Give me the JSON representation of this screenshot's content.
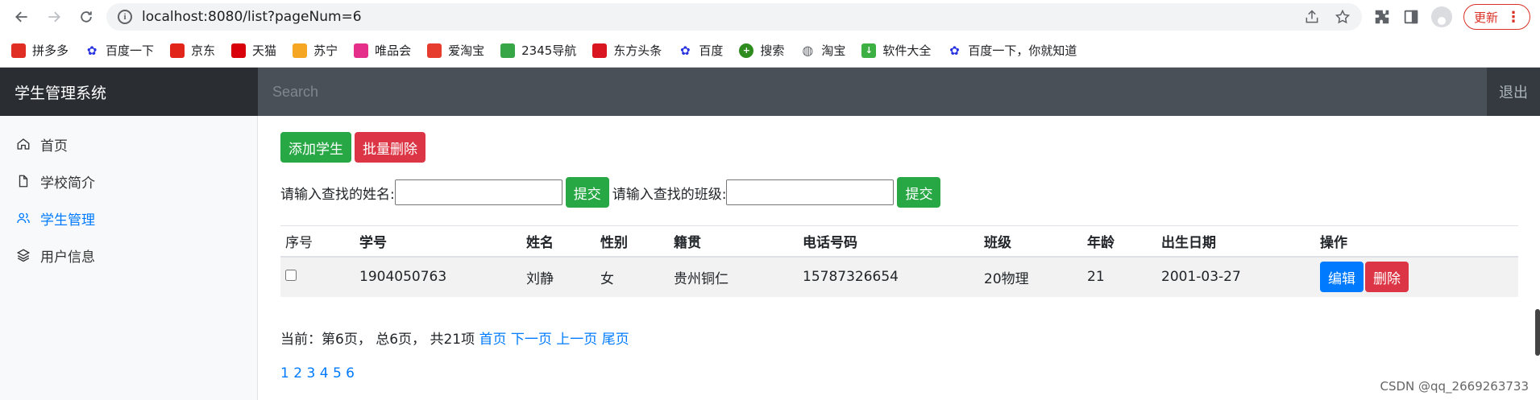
{
  "browser": {
    "url": "localhost:8080/list?pageNum=6",
    "update_label": "更新",
    "bookmarks": [
      {
        "label": "拼多多",
        "icon": "pinduoduo-icon",
        "color": "#e02e24"
      },
      {
        "label": "百度一下",
        "icon": "baidu-paw-icon",
        "color": "#2932e1"
      },
      {
        "label": "京东",
        "icon": "jd-icon",
        "color": "#e1251b"
      },
      {
        "label": "天猫",
        "icon": "tmall-icon",
        "color": "#d8000b"
      },
      {
        "label": "苏宁",
        "icon": "suning-icon",
        "color": "#f5a623"
      },
      {
        "label": "唯品会",
        "icon": "vip-icon",
        "color": "#e52e8a"
      },
      {
        "label": "爱淘宝",
        "icon": "aitaobao-icon",
        "color": "#e63c2e"
      },
      {
        "label": "2345导航",
        "icon": "2345-icon",
        "color": "#37a647"
      },
      {
        "label": "东方头条",
        "icon": "toutiao-icon",
        "color": "#d9161f"
      },
      {
        "label": "百度",
        "icon": "baidu-paw-icon",
        "color": "#2932e1"
      },
      {
        "label": "搜索",
        "icon": "search-plus-icon",
        "color": "#2e8b1e"
      },
      {
        "label": "淘宝",
        "icon": "globe-icon",
        "color": "#5f6368"
      },
      {
        "label": "软件大全",
        "icon": "download-icon",
        "color": "#3cb043"
      },
      {
        "label": "百度一下，你就知道",
        "icon": "baidu-paw-icon",
        "color": "#2932e1"
      }
    ]
  },
  "navbar": {
    "brand": "学生管理系统",
    "search_placeholder": "Search",
    "signout": "退出"
  },
  "sidebar": {
    "items": [
      {
        "label": "首页",
        "icon": "home-icon",
        "active": false
      },
      {
        "label": "学校简介",
        "icon": "file-icon",
        "active": false
      },
      {
        "label": "学生管理",
        "icon": "users-icon",
        "active": true
      },
      {
        "label": "用户信息",
        "icon": "layers-icon",
        "active": false
      }
    ]
  },
  "actions": {
    "add": "添加学生",
    "batch_delete": "批量删除"
  },
  "search": {
    "name_label": "请输入查找的姓名:",
    "class_label": "请输入查找的班级:",
    "submit": "提交"
  },
  "table": {
    "headers": [
      "序号",
      "学号",
      "姓名",
      "性别",
      "籍贯",
      "电话号码",
      "班级",
      "年龄",
      "出生日期",
      "操作"
    ],
    "rows": [
      {
        "id": "1904050763",
        "name": "刘静",
        "gender": "女",
        "hometown": "贵州铜仁",
        "phone": "15787326654",
        "class": "20物理",
        "age": "21",
        "birth": "2001-03-27"
      }
    ],
    "edit": "编辑",
    "delete": "删除"
  },
  "pagination": {
    "summary": "当前：第6页， 总6页， 共21项",
    "first": "首页",
    "next": "下一页",
    "prev": "上一页",
    "last": "尾页",
    "pages": [
      "1",
      "2",
      "3",
      "4",
      "5",
      "6"
    ]
  },
  "watermark": "CSDN @qq_2669263733"
}
